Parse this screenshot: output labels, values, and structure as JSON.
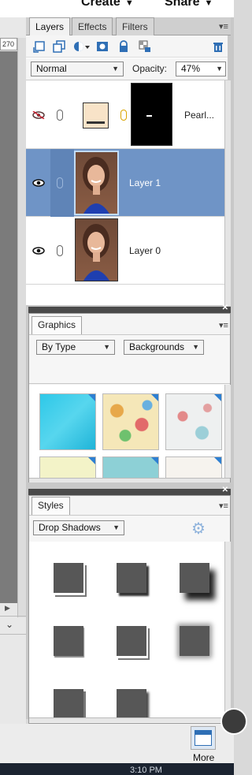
{
  "header": {
    "create_label": "Create",
    "share_label": "Share"
  },
  "zoom_field": "270",
  "layers_panel": {
    "tabs": [
      {
        "label": "Layers",
        "active": true
      },
      {
        "label": "Effects",
        "active": false
      },
      {
        "label": "Filters",
        "active": false
      }
    ],
    "blend_mode": "Normal",
    "opacity_label": "Opacity:",
    "opacity_value": "47%",
    "layers": [
      {
        "name": "Pearl...",
        "visible": false,
        "selected": false
      },
      {
        "name": "Layer 1",
        "visible": true,
        "selected": true
      },
      {
        "name": "Layer 0",
        "visible": true,
        "selected": false
      }
    ]
  },
  "graphics_panel": {
    "title": "Graphics",
    "filter_by": "By Type",
    "category": "Backgrounds"
  },
  "styles_panel": {
    "title": "Styles",
    "category": "Drop Shadows"
  },
  "footer": {
    "more_label": "More"
  },
  "taskbar": {
    "clock": "3:10 PM"
  },
  "colors": {
    "selection": "#6f94c6",
    "link_gold": "#d9a400",
    "accent_blue": "#2d7fd2"
  },
  "icons": [
    "new-layer-icon",
    "duplicate-layer-icon",
    "adjustment-layer-icon",
    "mask-icon",
    "lock-icon",
    "lock-transparent-icon",
    "trash-icon",
    "eye-icon",
    "hidden-eye-icon",
    "link-icon",
    "panel-menu-icon",
    "gear-icon",
    "close-icon"
  ]
}
